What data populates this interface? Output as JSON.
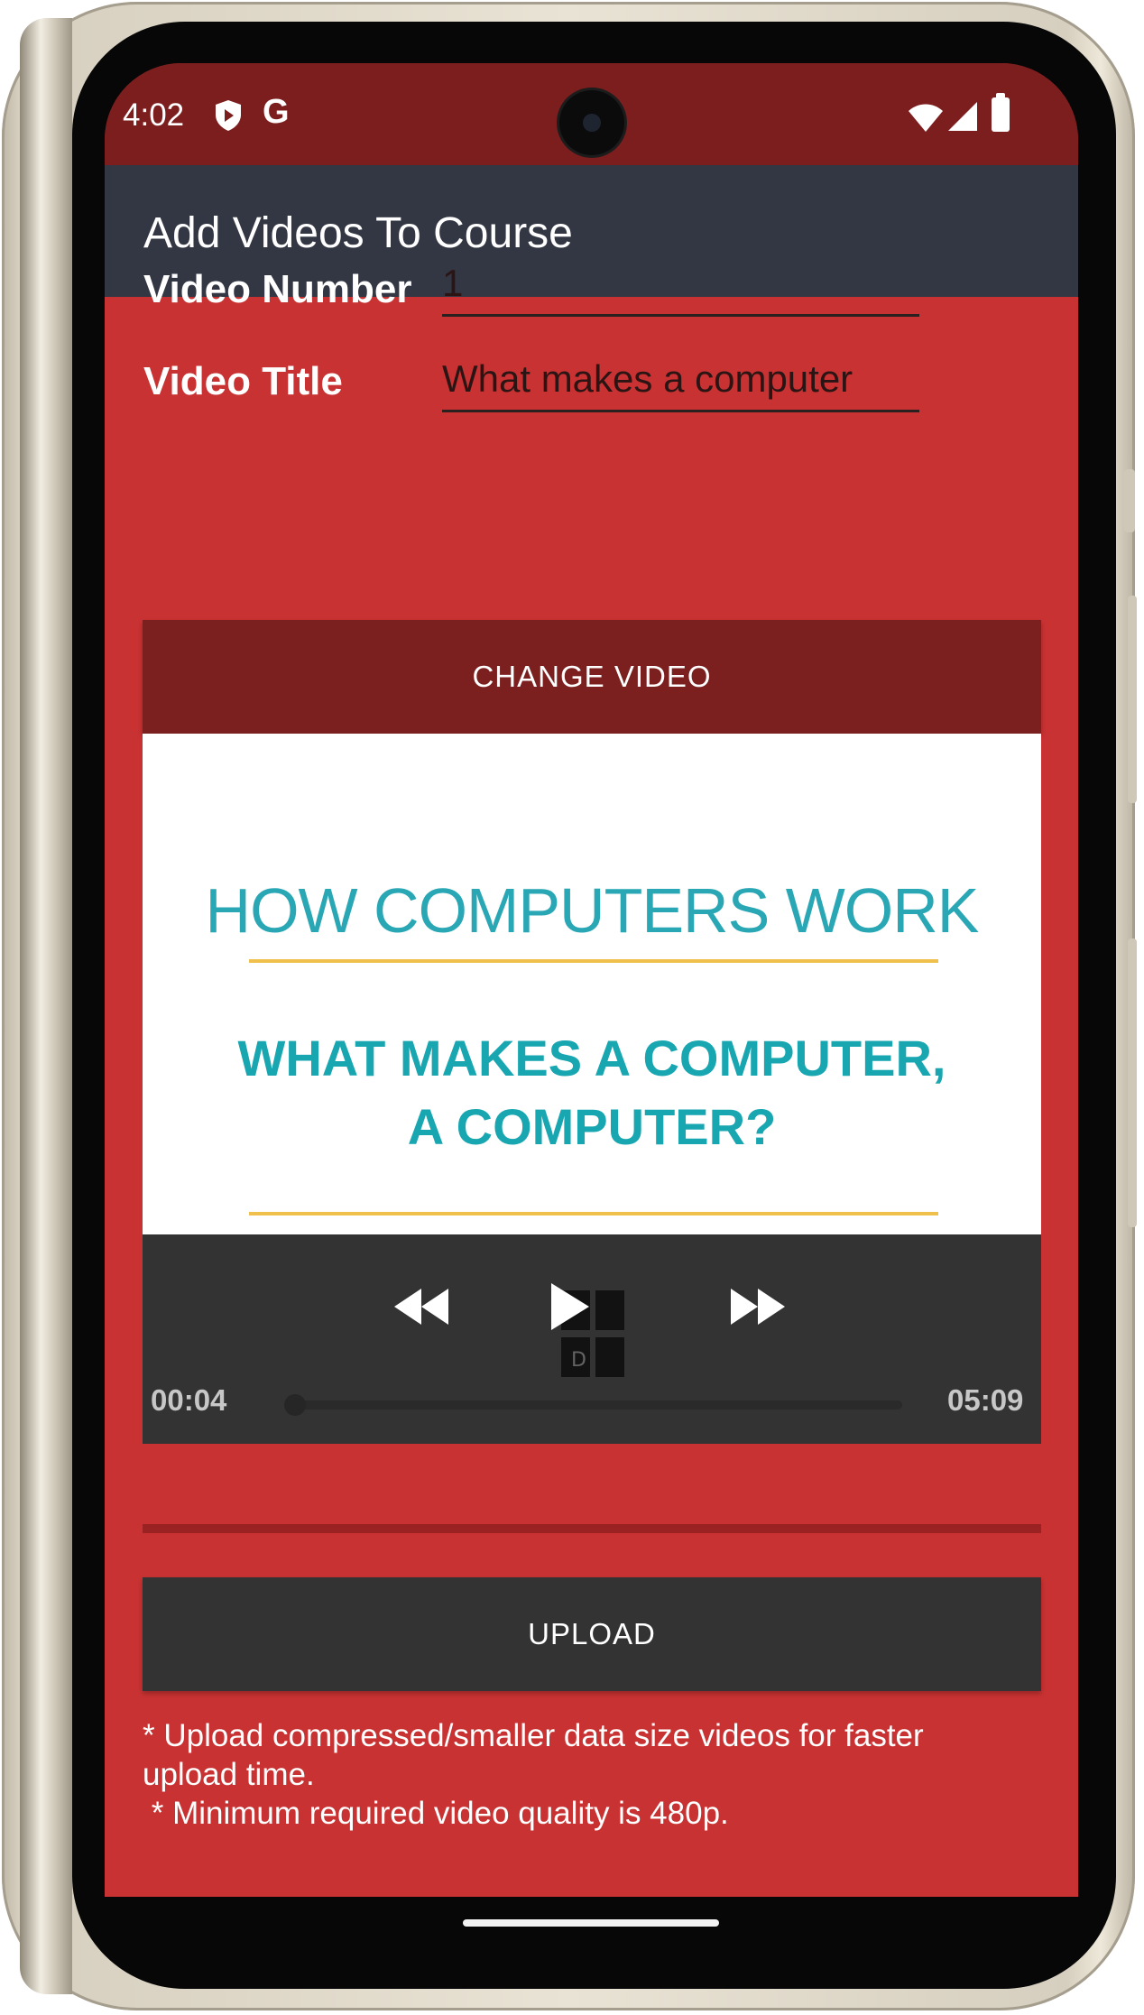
{
  "status_bar": {
    "time": "4:02",
    "icons": [
      "shield-icon",
      "google-icon",
      "wifi-icon",
      "signal-icon",
      "battery-icon"
    ],
    "google_glyph": "G",
    "background_color": "#7c1e1e"
  },
  "toolbar": {
    "title": "Add Videos To Course",
    "background_color": "#333744"
  },
  "form": {
    "video_number_label": "Video Number",
    "video_number_value": "1",
    "video_title_label": "Video Title",
    "video_title_value": "What makes a computer"
  },
  "change_video_button": {
    "label": "CHANGE VIDEO"
  },
  "video": {
    "thumbnail_heading": "HOW COMPUTERS WORK",
    "thumbnail_subtitle_line1": "WHAT MAKES A COMPUTER,",
    "thumbnail_subtitle_line2": "A COMPUTER?",
    "current_time": "00:04",
    "duration": "05:09",
    "controls": [
      "rewind-icon",
      "play-icon",
      "fast-forward-icon"
    ]
  },
  "upload_button": {
    "label": "UPLOAD"
  },
  "notes": {
    "line1": "* Upload compressed/smaller data size videos for faster\nupload time.",
    "line2": " * Minimum required video quality is 480p."
  },
  "colors": {
    "screen_background": "#c93232",
    "button_dark_red": "#7b1f1f",
    "button_dark": "#333333",
    "accent_teal": "#2aa7b4"
  }
}
